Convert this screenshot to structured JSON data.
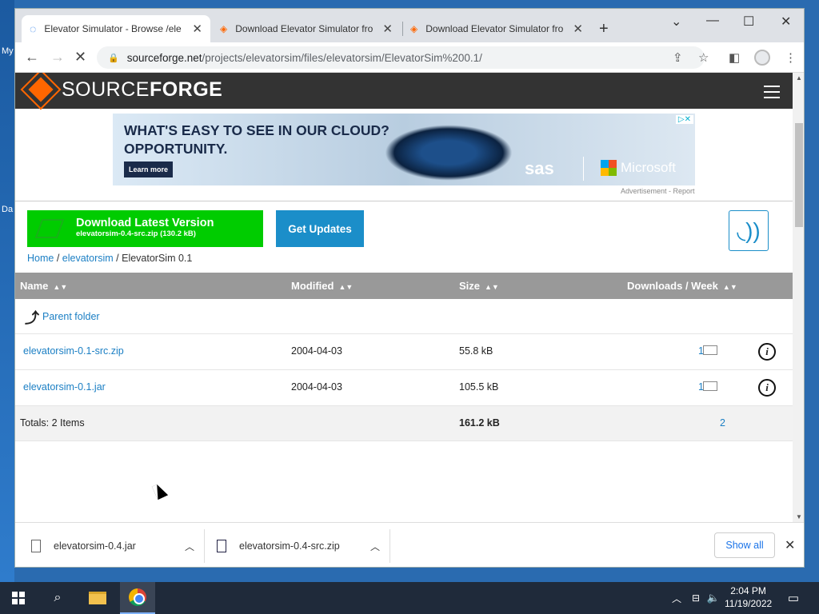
{
  "desktop": {
    "labels": [
      "My",
      "Da"
    ]
  },
  "browser": {
    "tabs": [
      {
        "title": "Elevator Simulator - Browse /ele",
        "active": true
      },
      {
        "title": "Download Elevator Simulator fro",
        "active": false
      },
      {
        "title": "Download Elevator Simulator fro",
        "active": false
      }
    ],
    "new_tab": "+",
    "controls": {
      "minimize": "⌄",
      "restore": "—",
      "maximize": "☐",
      "close": "✕"
    },
    "url_host": "sourceforge.net",
    "url_path": "/projects/elevatorsim/files/elevatorsim/ElevatorSim%200.1/"
  },
  "site": {
    "logo_text_1": "SOURCE",
    "logo_text_2": "FORGE",
    "ad": {
      "headline_1": "WHAT'S EASY TO SEE IN OUR CLOUD?",
      "headline_2": "OPPORTUNITY.",
      "cta": "Learn more",
      "brand_1": "sas",
      "brand_2": "Microsoft",
      "label": "Advertisement - Report"
    },
    "download": {
      "main": "Download Latest Version",
      "sub": "elevatorsim-0.4-src.zip (130.2 kB)"
    },
    "get_updates": "Get Updates",
    "breadcrumb": [
      "Home",
      "elevatorsim",
      "ElevatorSim 0.1"
    ],
    "table": {
      "headers": [
        "Name",
        "Modified",
        "Size",
        "Downloads / Week"
      ],
      "parent": "Parent folder",
      "rows": [
        {
          "name": "elevatorsim-0.1-src.zip",
          "modified": "2004-04-03",
          "size": "55.8 kB",
          "downloads": "1"
        },
        {
          "name": "elevatorsim-0.1.jar",
          "modified": "2004-04-03",
          "size": "105.5 kB",
          "downloads": "1"
        }
      ],
      "totals_label": "Totals: 2 Items",
      "totals_size": "161.2 kB",
      "totals_downloads": "2"
    }
  },
  "downloads_bar": {
    "items": [
      "elevatorsim-0.4.jar",
      "elevatorsim-0.4-src.zip"
    ],
    "show_all": "Show all"
  },
  "taskbar": {
    "time": "2:04 PM",
    "date": "11/19/2022"
  }
}
